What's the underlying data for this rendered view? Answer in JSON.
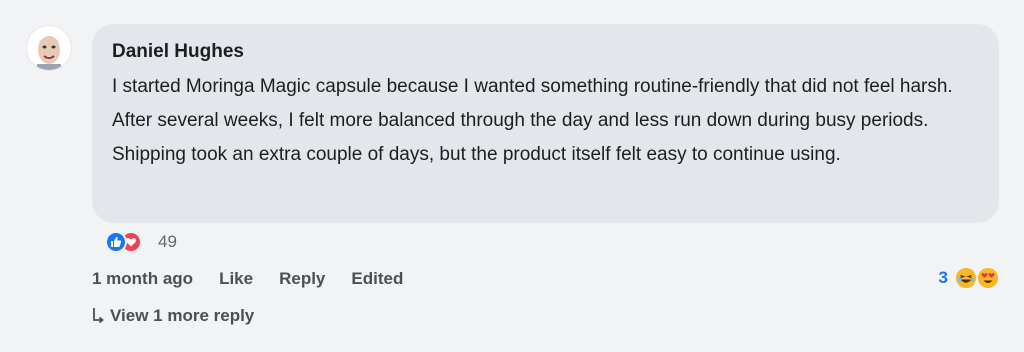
{
  "comment": {
    "author": "Daniel Hughes",
    "text": "I started Moringa Magic capsule because I wanted something routine-friendly that did not feel harsh. After several weeks, I felt more balanced through the day and less run down during busy periods. Shipping took an extra couple of days, but the product itself felt easy to continue using.",
    "reactions": {
      "icons": [
        "like-icon",
        "love-icon"
      ],
      "count": "49"
    },
    "actions": {
      "time": "1 month ago",
      "like_label": "Like",
      "reply_label": "Reply",
      "edited_label": "Edited"
    },
    "reply_reactions": {
      "count": "3",
      "icons": [
        "laughing-emoji-icon",
        "heart-eyes-emoji-icon"
      ]
    },
    "view_replies_label": "View 1 more reply"
  },
  "colors": {
    "background": "#f2f3f5",
    "bubble": "#e4e6eb",
    "like_blue": "#1877f2",
    "love_red": "#f33e58",
    "count_blue": "#1a73e8"
  }
}
